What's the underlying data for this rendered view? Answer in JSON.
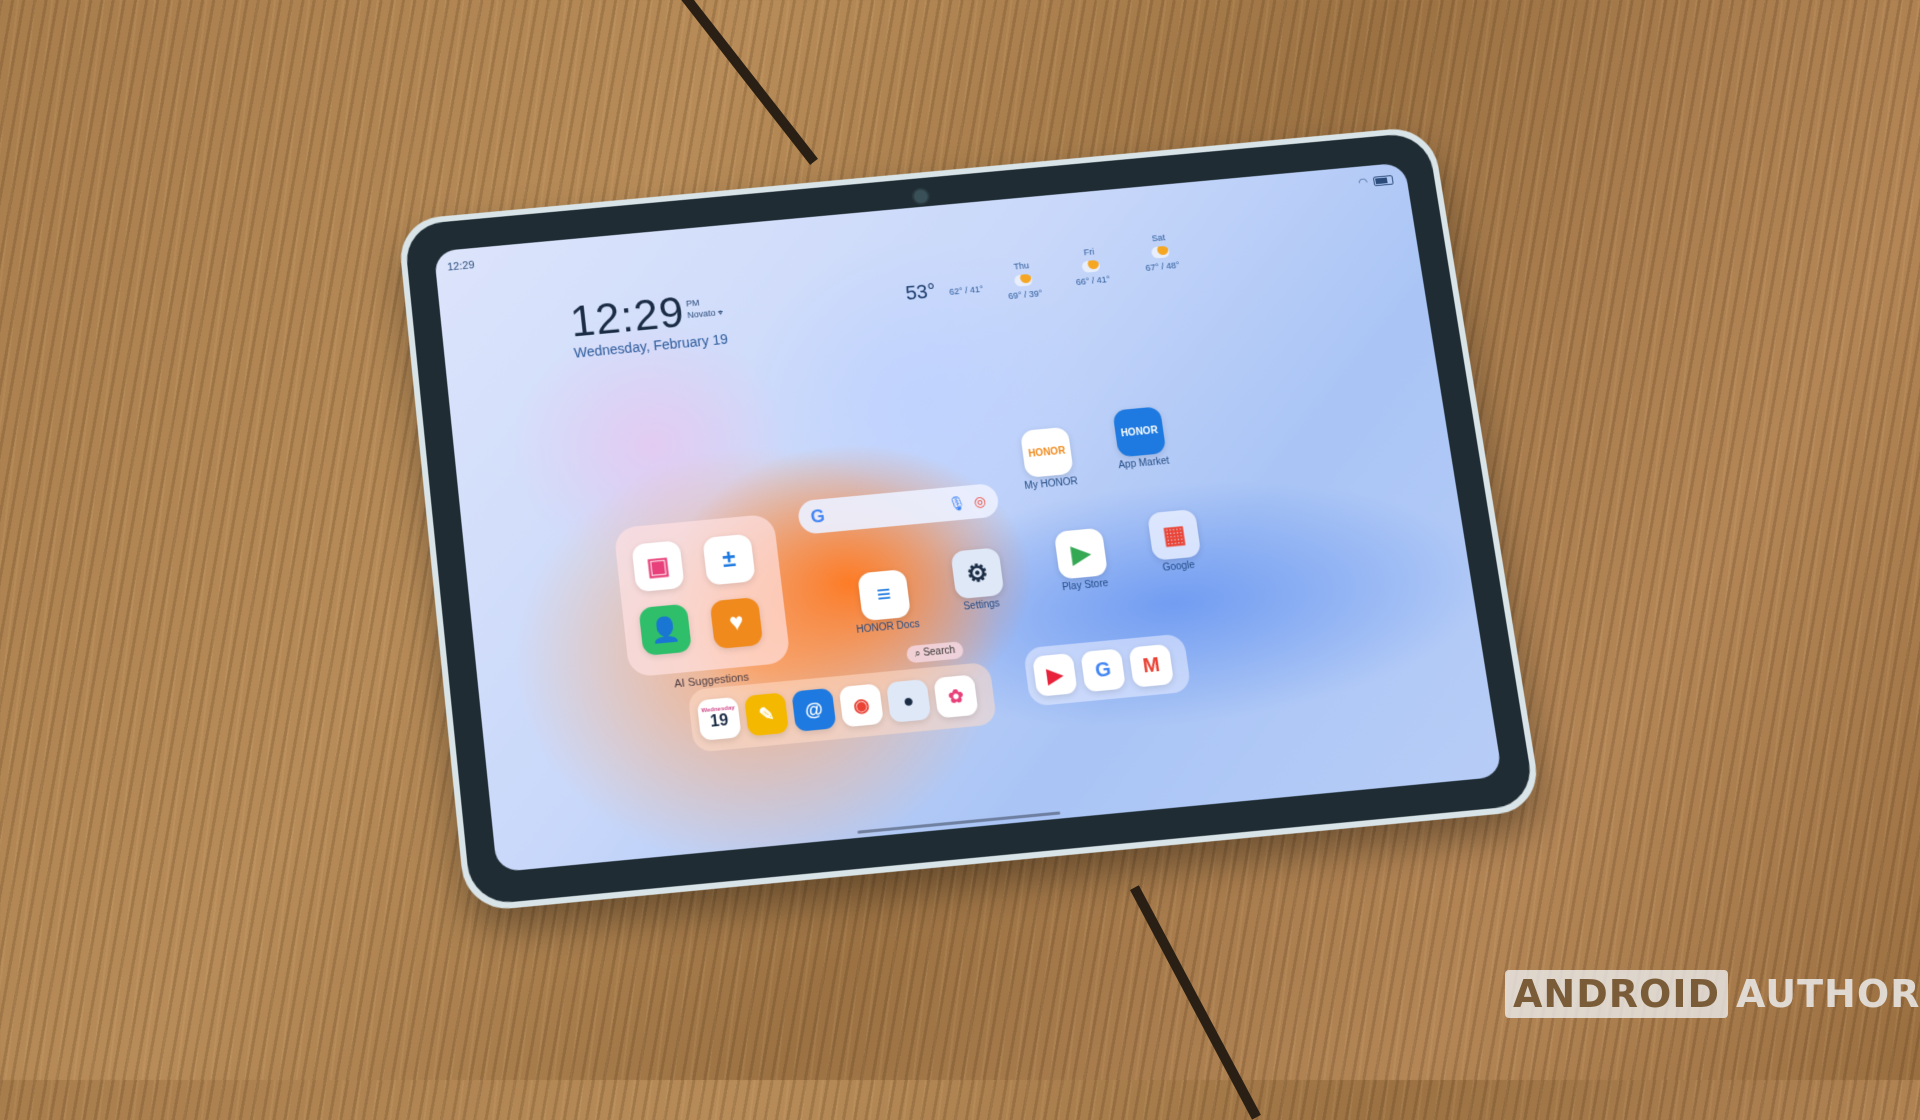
{
  "status_bar": {
    "time": "12:29",
    "wifi_icon": "wifi-icon",
    "battery_icon": "battery-icon"
  },
  "clock_widget": {
    "time": "12:29",
    "ampm": "PM",
    "location": "Novato",
    "date": "Wednesday, February 19"
  },
  "weather_widget": {
    "current": {
      "temp": "53°",
      "range": "62° / 41°"
    },
    "forecast": [
      {
        "day": "Thu",
        "range": "69° / 39°"
      },
      {
        "day": "Fri",
        "range": "66° / 41°"
      },
      {
        "day": "Sat",
        "range": "67° / 48°"
      }
    ]
  },
  "folder": {
    "label": "AI Suggestions",
    "apps": [
      "Multi-window",
      "Calculator",
      "Contacts",
      "Health"
    ]
  },
  "search_widget": {
    "logo": "G",
    "mic_icon": "microphone-icon",
    "lens_icon": "lens-icon"
  },
  "apps": [
    {
      "label": "My HONOR",
      "glyph": "HONOR"
    },
    {
      "label": "App Market",
      "glyph": "HONOR"
    },
    {
      "label": "HONOR Docs",
      "glyph": "≡"
    },
    {
      "label": "Settings",
      "glyph": "⚙"
    },
    {
      "label": "Play Store",
      "glyph": "▶"
    },
    {
      "label": "Google",
      "glyph": "▦"
    }
  ],
  "search_pill": "Search",
  "dock": {
    "calendar_day": "Wednesday",
    "calendar_date": "19",
    "apps": [
      "Calendar",
      "Notes",
      "Email",
      "Chrome",
      "Camera",
      "Gallery"
    ],
    "recent": [
      "YouTube",
      "Google",
      "Gmail"
    ]
  },
  "watermark": {
    "boxed": "ANDROID",
    "text": "AUTHORITY"
  },
  "colors": {
    "accent": "#2b5a9a",
    "honor_blue": "#1e7ae0",
    "honor_orange": "#f08a1c"
  }
}
